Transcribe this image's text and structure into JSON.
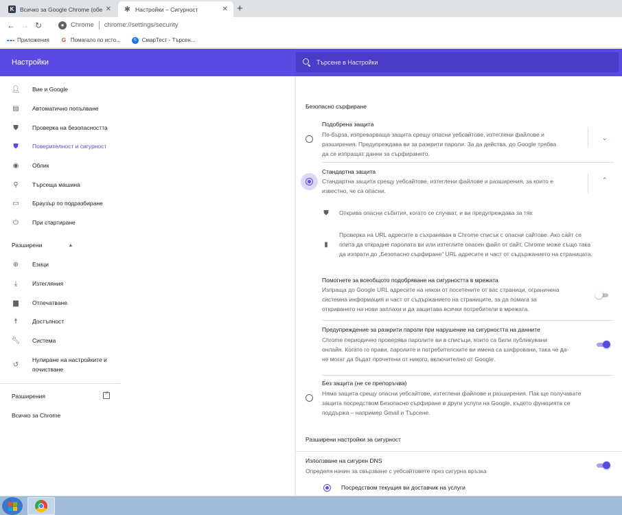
{
  "tabs": [
    {
      "title": "Всичко за Google Chrome (обе",
      "favicon": "k-icon"
    },
    {
      "title": "Настройки – Сигурност",
      "favicon": "gear-icon"
    }
  ],
  "toolbar": {
    "chip": "Chrome",
    "url": "chrome://settings/security"
  },
  "bookmarks": [
    {
      "label": "Приложения",
      "icon": "apps-icon"
    },
    {
      "label": "Помагало по исто...",
      "icon": "google-icon"
    },
    {
      "label": "СмарТест - Търсен...",
      "icon": "smartest-icon"
    }
  ],
  "header": {
    "title": "Настройки",
    "search_placeholder": "Търсене в Настройки"
  },
  "sidebar": {
    "items": [
      {
        "label": "Вие и Google",
        "icon": "person-icon"
      },
      {
        "label": "Автоматично попълване",
        "icon": "clipboard-icon"
      },
      {
        "label": "Проверка на безопасността",
        "icon": "shield-check-icon"
      },
      {
        "label": "Поверителност и сигурност",
        "icon": "privacy-shield-icon"
      },
      {
        "label": "Облик",
        "icon": "palette-icon"
      },
      {
        "label": "Търсеща машина",
        "icon": "search-icon"
      },
      {
        "label": "Браузър по подразбиране",
        "icon": "browser-icon"
      },
      {
        "label": "При стартиране",
        "icon": "power-icon"
      }
    ],
    "advanced_label": "Разширени",
    "advanced_items": [
      {
        "label": "Езици",
        "icon": "globe-icon"
      },
      {
        "label": "Изтегляния",
        "icon": "download-icon"
      },
      {
        "label": "Отпечатване",
        "icon": "printer-icon"
      },
      {
        "label": "Достъпност",
        "icon": "accessibility-icon"
      },
      {
        "label": "Система",
        "icon": "wrench-icon"
      },
      {
        "label": "Нулиране на настройките и",
        "label2": "почистване",
        "icon": "restore-icon"
      }
    ],
    "extensions_label": "Разширения",
    "about_label": "Всичко за Chrome"
  },
  "main": {
    "section_title": "Безопасно сърфиране",
    "enhanced": {
      "title": "Подобрена защита",
      "desc1": "По-бърза, изпреварваща защита срещу опасни уебсайтове, изтеглени файлове и",
      "desc2": "разширения. Предупреждава ви за разкрити пароли. За да действа, до Google трябва",
      "desc3": "да се изпращат данни за сърфирането."
    },
    "standard": {
      "title": "Стандартна защита",
      "desc1": "Стандартна защита срещу уебсайтове, изтеглени файлове и разширения, за които е",
      "desc2": "известно, че са опасни.",
      "sub1": "Открива опасни събития, когато се случват, и ви предупреждава за тях",
      "sub2_1": "Проверка на URL адресите в съхраняван в Chrome списък с опасни сайтове. Ако сайт се",
      "sub2_2": "опита да открадне паролата ви или изтеглите опасен файл от сайт, Chrome може също така",
      "sub2_3": "да изпрати до „Безопасно сърфиране“ URL адресите и част от съдържанието на страницата."
    },
    "help_improve": {
      "title": "Помогнете за всеобщото подобряване на сигурността в мрежата",
      "desc1": "Изпраща до Google URL адресите на някои от посетените от вас страници, ограничена",
      "desc2": "системна информация и част от съдържанието на страниците, за да помага за",
      "desc3": "откриването на нови заплахи и да защитава всички потребители в мрежата.",
      "enabled": false
    },
    "password_warning": {
      "title": "Предупреждение за разкрити пароли при нарушение на сигурността на данните",
      "desc1": "Chrome периодично проверява паролите ви в списъци, които са били публикувани",
      "desc2": "онлайн. Когато го прави, паролите и потребителските ви имена са шифровани, така че да-",
      "desc3": "не могат да бъдат прочетени от никого, включително от Google.",
      "enabled": true
    },
    "no_protection": {
      "title": "Без защита (не се препоръчва)",
      "desc1": "Няма защита срещу опасни уебсайтове, изтеглени файлове и разширения. Пак ще получавате",
      "desc2": "защита посредством Безопасно сърфиране в други услуги на Google, където функцията се",
      "desc3": "поддържа – например Gmail и Търсене."
    },
    "advanced_title": "Разширени настройки за сигурност",
    "secure_dns": {
      "title": "Използване на сигурен DNS",
      "desc": "Определя начин за свързване с уебсайтовете през сигурна връзка",
      "enabled": true,
      "option": "Посредством текущия ви доставчик на услуги"
    }
  },
  "colors": {
    "accent": "#5a4ae3",
    "header_bg": "#5a4ae3"
  }
}
